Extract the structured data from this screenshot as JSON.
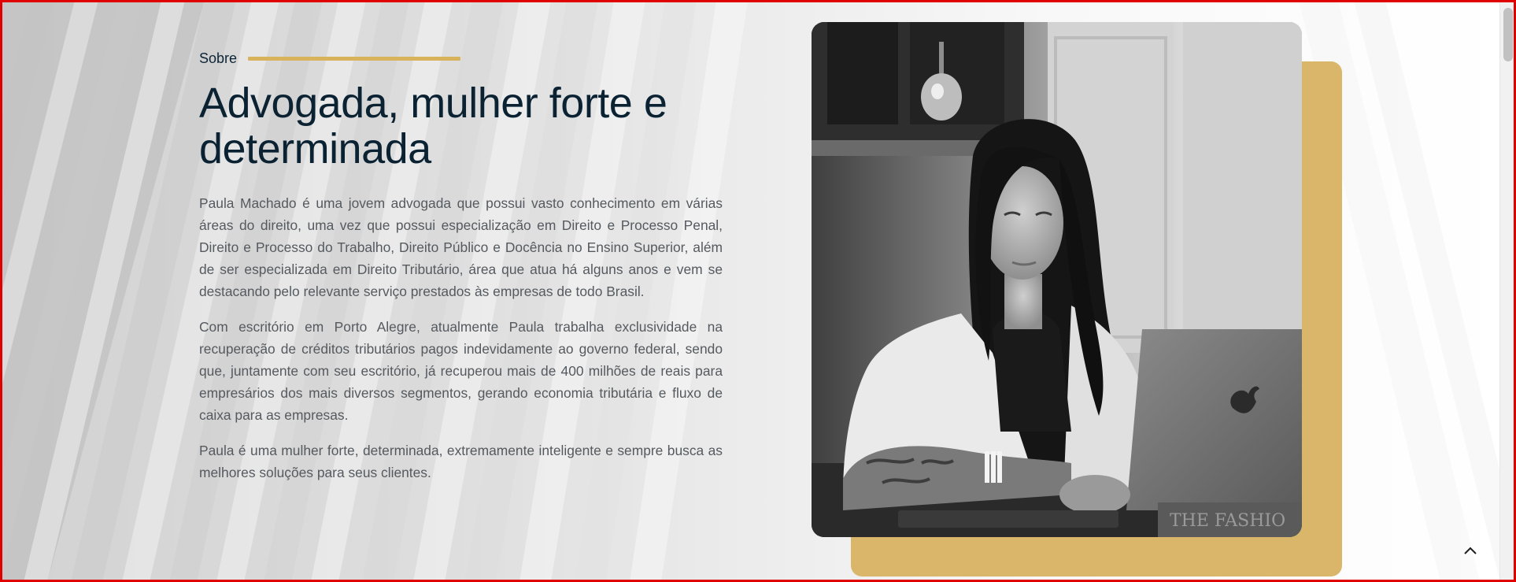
{
  "about": {
    "eyebrow": "Sobre",
    "title": "Advogada, mulher forte e determinada",
    "paragraphs": [
      "Paula Machado é uma jovem advogada que possui vasto conhecimento em várias áreas do direito, uma vez que possui especialização em Direito e Processo Penal, Direito e Processo do Trabalho, Direito Público e Docência no Ensino Superior, além de ser especializada em Direito Tributário, área que atua há alguns anos e vem se destacando pelo relevante serviço prestados às empresas de todo Brasil.",
      "Com escritório em Porto Alegre, atualmente Paula trabalha exclusividade na recuperação de créditos tributários pagos indevidamente ao governo federal, sendo que, juntamente com seu escritório, já recuperou mais de 400 milhões de reais para empresários dos mais diversos segmentos, gerando economia tributária e fluxo de caixa para as empresas.",
      "Paula é uma mulher forte, determinada, extremamente inteligente e sempre busca as melhores soluções para seus clientes."
    ]
  },
  "photo": {
    "book_text": "THE FASHIO"
  },
  "colors": {
    "accent_gold": "#d9b35b",
    "title_navy": "#0b2233",
    "body_gray": "#555a5f",
    "frame_red": "#e00000"
  },
  "icons": {
    "back_to_top": "chevron-up-icon",
    "laptop_logo": "apple-logo-icon"
  }
}
